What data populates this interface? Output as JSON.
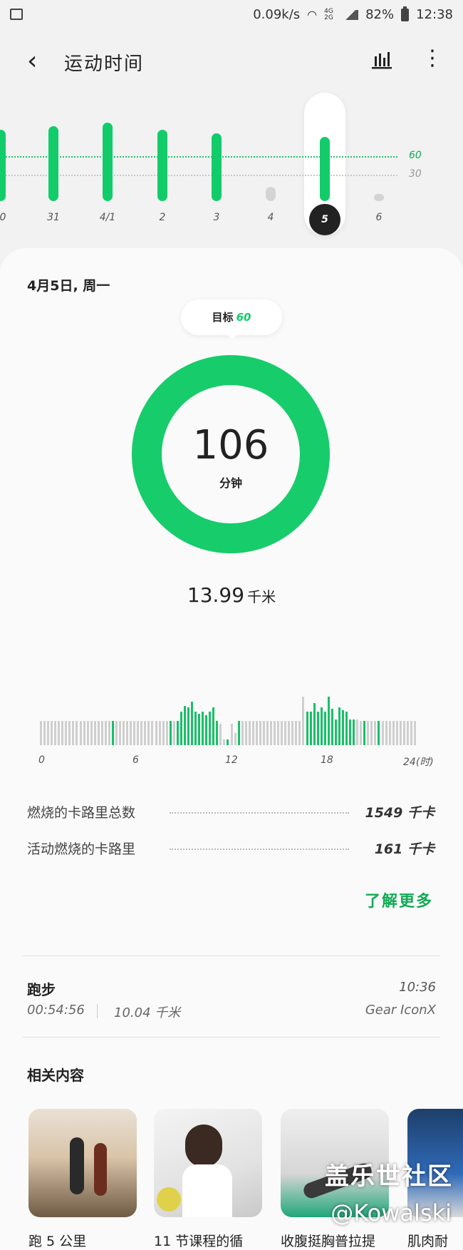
{
  "status": {
    "net_speed": "0.09k/s",
    "net_types": "4G 2G",
    "battery": "82%",
    "time": "12:38"
  },
  "header": {
    "title": "运动时间"
  },
  "chart_data": {
    "type": "bar",
    "categories": [
      "0",
      "31",
      "4/1",
      "2",
      "3",
      "4",
      "5",
      "6"
    ],
    "values": [
      100,
      105,
      110,
      100,
      95,
      20,
      90,
      10
    ],
    "selected_category": "5",
    "goal_lines": [
      60,
      30
    ],
    "goal_labels": [
      "60",
      "30"
    ],
    "colors": {
      "met": "#12cc6a",
      "unmet": "#d4d4d4"
    }
  },
  "summary": {
    "date": "4月5日, 周一",
    "goal_label": "目标",
    "goal_value": "60",
    "minutes": "106",
    "minutes_unit": "分钟",
    "distance": "13.99",
    "distance_unit": "千米"
  },
  "hourly": {
    "axis_labels": [
      "0",
      "6",
      "12",
      "18",
      "24(时)"
    ],
    "bars": [
      0.4,
      0.4,
      0.4,
      0.4,
      0.4,
      0.4,
      0.4,
      0.4,
      0.4,
      0.4,
      0.4,
      0.4,
      0.4,
      0.4,
      0.4,
      0.4,
      0.4,
      0.4,
      0.4,
      0.4,
      0.4,
      0.4,
      0.4,
      0.4,
      0.4,
      0.4,
      0.4,
      0.4,
      0.4,
      0.4,
      0.4,
      0.4,
      0.4,
      0.4,
      0.4,
      0.4,
      0.4,
      0.4,
      0.4,
      0.55,
      0.65,
      0.62,
      0.72,
      0.55,
      0.52,
      0.55,
      0.5,
      0.55,
      0.62,
      0.4,
      0.35,
      0.1,
      0.1,
      0.35,
      0.2,
      0.4,
      0.4,
      0.4,
      0.4,
      0.4,
      0.4,
      0.4,
      0.4,
      0.4,
      0.4,
      0.4,
      0.4,
      0.4,
      0.4,
      0.4,
      0.4,
      0.4,
      0.4,
      0.8,
      0.55,
      0.55,
      0.7,
      0.55,
      0.62,
      0.55,
      0.8,
      0.6,
      0.42,
      0.62,
      0.58,
      0.55,
      0.42,
      0.42,
      0.42,
      0.4,
      0.4,
      0.4,
      0.4,
      0.4,
      0.4,
      0.4,
      0.4,
      0.4,
      0.4,
      0.4,
      0.4,
      0.4,
      0.4,
      0.4,
      0.4
    ],
    "green": [
      20,
      36,
      38,
      39,
      40,
      41,
      42,
      43,
      44,
      45,
      46,
      47,
      48,
      49,
      52,
      55,
      74,
      75,
      76,
      77,
      78,
      79,
      80,
      81,
      82,
      83,
      84,
      85,
      86,
      87,
      90,
      94
    ]
  },
  "stats": [
    {
      "label": "燃烧的卡路里总数",
      "value": "1549",
      "unit": "千卡"
    },
    {
      "label": "活动燃烧的卡路里",
      "value": "161",
      "unit": "千卡"
    }
  ],
  "learn_more": "了解更多",
  "activity": {
    "name": "跑步",
    "time": "10:36",
    "duration": "00:54:56",
    "distance": "10.04 千米",
    "device": "Gear IconX"
  },
  "related": {
    "title": "相关内容",
    "items": [
      {
        "label": "跑 5 公里"
      },
      {
        "label": "11 节课程的循"
      },
      {
        "label": "收腹挺胸普拉提"
      },
      {
        "label": "肌肉耐"
      }
    ]
  },
  "watermark": {
    "line1": "盖乐世社区",
    "line2": "@Kowalski"
  }
}
